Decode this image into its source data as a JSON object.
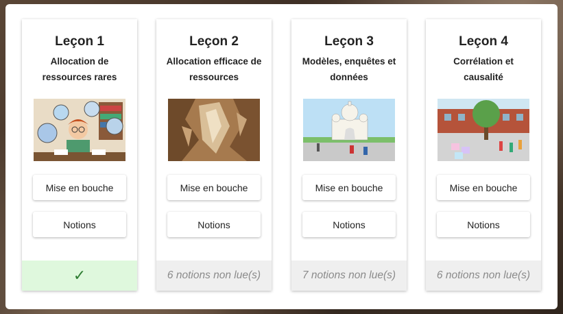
{
  "lessons": [
    {
      "title": "Leçon 1",
      "subtitle": "Allocation de ressources rares",
      "buttons": {
        "intro": "Mise en bouche",
        "notions": "Notions"
      },
      "status": "completed",
      "footer_text": ""
    },
    {
      "title": "Leçon 2",
      "subtitle": "Allocation efficace de ressources",
      "buttons": {
        "intro": "Mise en bouche",
        "notions": "Notions"
      },
      "status": "pending",
      "footer_text": "6 notions non lue(s)"
    },
    {
      "title": "Leçon 3",
      "subtitle": "Modèles, enquêtes et données",
      "buttons": {
        "intro": "Mise en bouche",
        "notions": "Notions"
      },
      "status": "pending",
      "footer_text": "7 notions non lue(s)"
    },
    {
      "title": "Leçon 4",
      "subtitle": "Corrélation et causalité",
      "buttons": {
        "intro": "Mise en bouche",
        "notions": "Notions"
      },
      "status": "pending",
      "footer_text": "6 notions non lue(s)"
    }
  ],
  "icons": {
    "completed": "checkmark-icon"
  },
  "colors": {
    "completed_bg": "#dff8dd",
    "pending_bg": "#efefef",
    "check": "#2e7d32"
  }
}
